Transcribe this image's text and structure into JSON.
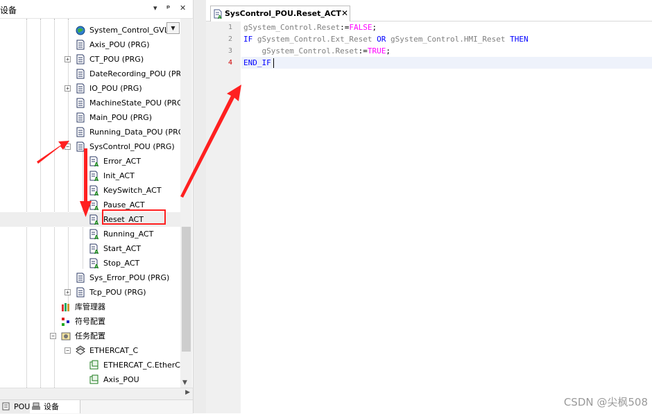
{
  "left_panel": {
    "title": "设备",
    "pin_glyph": "▾",
    "dock_glyph": "ᵩ",
    "close_glyph": "✕",
    "combo_glyph": "▼"
  },
  "tree": {
    "items": [
      {
        "label": "System_Control_GVL",
        "icon": "globe-icon"
      },
      {
        "label": "Axis_POU (PRG)",
        "icon": "pou-icon"
      },
      {
        "label": "CT_POU (PRG)",
        "icon": "pou-icon",
        "expander": "+"
      },
      {
        "label": "DateRecording_POU (PRG)",
        "icon": "pou-icon"
      },
      {
        "label": "IO_POU (PRG)",
        "icon": "pou-icon",
        "expander": "+"
      },
      {
        "label": "MachineState_POU (PRG)",
        "icon": "pou-icon"
      },
      {
        "label": "Main_POU (PRG)",
        "icon": "pou-icon"
      },
      {
        "label": "Running_Data_POU (PRG)",
        "icon": "pou-icon"
      },
      {
        "label": "SysControl_POU (PRG)",
        "icon": "pou-icon",
        "expander": "−"
      },
      {
        "label": "Error_ACT",
        "icon": "action-icon"
      },
      {
        "label": "Init_ACT",
        "icon": "action-icon"
      },
      {
        "label": "KeySwitch_ACT",
        "icon": "action-icon"
      },
      {
        "label": "Pause_ACT",
        "icon": "action-icon"
      },
      {
        "label": "Reset_ACT",
        "icon": "action-icon"
      },
      {
        "label": "Running_ACT",
        "icon": "action-icon"
      },
      {
        "label": "Start_ACT",
        "icon": "action-icon"
      },
      {
        "label": "Stop_ACT",
        "icon": "action-icon"
      },
      {
        "label": "Sys_Error_POU (PRG)",
        "icon": "pou-icon"
      },
      {
        "label": "Tcp_POU (PRG)",
        "icon": "pou-icon",
        "expander": "+"
      },
      {
        "label": "库管理器",
        "icon": "library-icon"
      },
      {
        "label": "符号配置",
        "icon": "symbol-config-icon"
      },
      {
        "label": "任务配置",
        "icon": "task-config-icon",
        "expander": "−"
      },
      {
        "label": "ETHERCAT_C",
        "icon": "ethercat-task-icon",
        "expander": "−"
      },
      {
        "label": "ETHERCAT_C.EtherCA",
        "icon": "task-call-icon"
      },
      {
        "label": "Axis_POU",
        "icon": "task-call-icon"
      }
    ]
  },
  "bottom_tabs": [
    {
      "label": "POUs",
      "icon": "pous-icon"
    },
    {
      "label": "设备",
      "icon": "devices-icon"
    }
  ],
  "editor": {
    "tab_title": "SysControl_POU.Reset_ACT",
    "tab_close": "✕",
    "line_numbers": [
      "1",
      "2",
      "3",
      "4"
    ],
    "current_line": "4",
    "code_lines": [
      [
        {
          "t": "gSystem_Control.Reset",
          "c": "vr"
        },
        {
          "t": ":=",
          "c": "pnc"
        },
        {
          "t": "FALSE",
          "c": "lit"
        },
        {
          "t": ";",
          "c": "pnc"
        }
      ],
      [
        {
          "t": "IF ",
          "c": "kw"
        },
        {
          "t": "gSystem_Control.Ext_Reset",
          "c": "vr"
        },
        {
          "t": " OR ",
          "c": "kw"
        },
        {
          "t": "gSystem_Control.HMI_Reset",
          "c": "vr"
        },
        {
          "t": " THEN",
          "c": "kw"
        }
      ],
      [
        {
          "t": "    gSystem_Control.Reset",
          "c": "vr"
        },
        {
          "t": ":=",
          "c": "pnc"
        },
        {
          "t": "TRUE",
          "c": "lit"
        },
        {
          "t": ";",
          "c": "pnc"
        }
      ],
      [
        {
          "t": "END_IF",
          "c": "kw"
        }
      ]
    ]
  },
  "watermark": "CSDN @尖枫508",
  "colors": {
    "keyword": "#0000ff",
    "variable": "#7f7f7f",
    "literal": "#ff00ff",
    "annotation": "#ff2020"
  }
}
